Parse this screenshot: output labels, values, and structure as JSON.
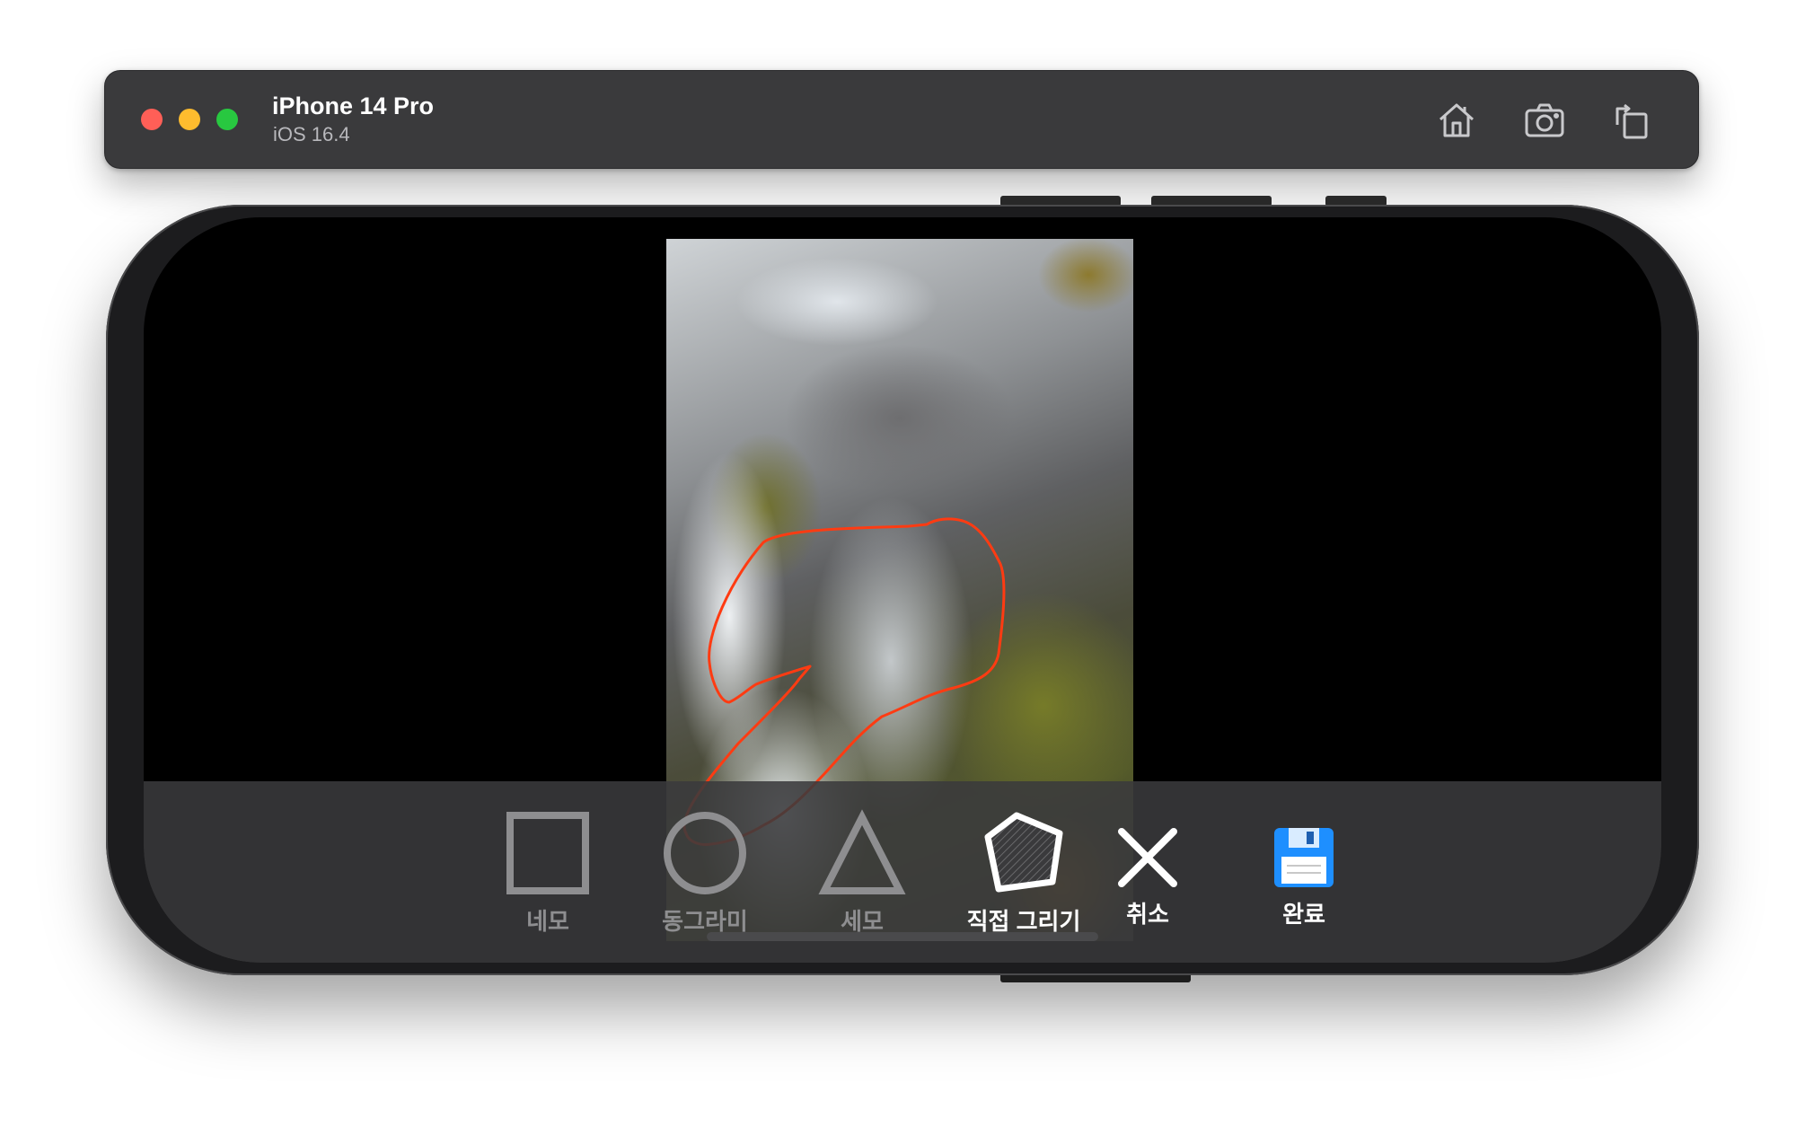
{
  "window": {
    "device_name": "iPhone 14 Pro",
    "os_version": "iOS 16.4",
    "toolbar_icons": [
      "home-icon",
      "screenshot-icon",
      "rotate-icon"
    ]
  },
  "photo": {
    "subject": "waterfall over mossy rocks",
    "overlay_stroke_color": "#ff3b12"
  },
  "toolbar": {
    "items": [
      {
        "label": "네모",
        "icon": "rectangle-icon",
        "state": "inactive"
      },
      {
        "label": "동그라미",
        "icon": "circle-icon",
        "state": "inactive"
      },
      {
        "label": "세모",
        "icon": "triangle-icon",
        "state": "inactive"
      },
      {
        "label": "직접 그리기",
        "icon": "freeform-polygon-icon",
        "state": "selected"
      },
      {
        "label": "취소",
        "icon": "close-icon",
        "state": "active"
      },
      {
        "label": "완료",
        "icon": "floppy-disk-icon",
        "state": "active"
      }
    ]
  },
  "colors": {
    "titlebar": "#3a3a3c",
    "inactive_tool": "#8e8e90",
    "active_tool": "#ffffff",
    "save_icon_blue": "#1e8fff",
    "drawing_stroke": "#ff3b12"
  }
}
